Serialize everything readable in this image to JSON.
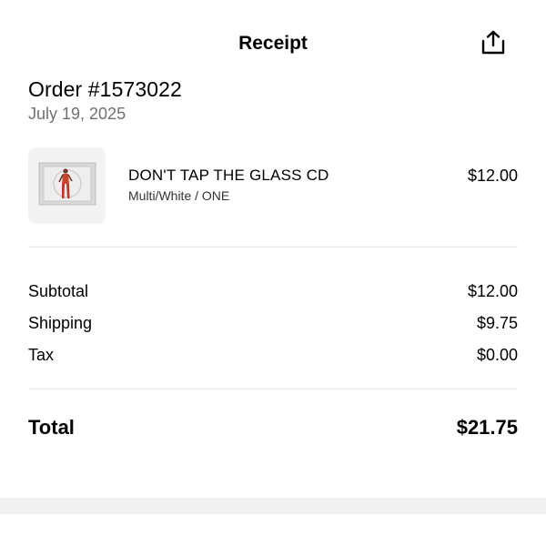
{
  "header": {
    "title": "Receipt",
    "share_icon": "share-upload-icon"
  },
  "order": {
    "number_label": "Order #1573022",
    "date": "July 19, 2025"
  },
  "item": {
    "name": "DON'T TAP THE GLASS CD",
    "variant": "Multi/White / ONE",
    "price": "$12.00",
    "thumbnail_icon": "album-cover-image"
  },
  "summary": {
    "subtotal_label": "Subtotal",
    "subtotal_value": "$12.00",
    "shipping_label": "Shipping",
    "shipping_value": "$9.75",
    "tax_label": "Tax",
    "tax_value": "$0.00"
  },
  "total": {
    "label": "Total",
    "value": "$21.75"
  },
  "colors": {
    "text": "#000000",
    "muted": "#707070",
    "divider": "#e6e6e6",
    "thumb_bg": "#f3f3f3",
    "footer_band": "#f0f0f0"
  }
}
